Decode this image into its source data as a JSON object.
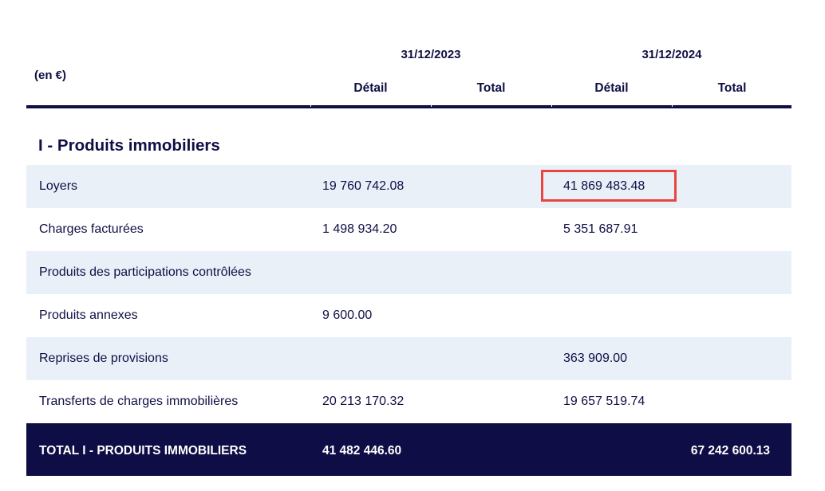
{
  "header": {
    "unit": "(en €)",
    "dates": [
      "31/12/2023",
      "31/12/2024"
    ],
    "subcols": [
      "Détail",
      "Total",
      "Détail",
      "Total"
    ]
  },
  "section": {
    "title": "I - Produits immobiliers"
  },
  "rows": [
    {
      "label": "Loyers",
      "detail_2023": "19 760 742.08",
      "detail_2024": "41 869 483.48"
    },
    {
      "label": "Charges facturées",
      "detail_2023": "1 498 934.20",
      "detail_2024": "5 351 687.91"
    },
    {
      "label": "Produits des participations contrôlées",
      "detail_2023": "",
      "detail_2024": ""
    },
    {
      "label": "Produits annexes",
      "detail_2023": "9 600.00",
      "detail_2024": ""
    },
    {
      "label": "Reprises de provisions",
      "detail_2023": "",
      "detail_2024": "363 909.00"
    },
    {
      "label": "Transferts de charges immobilières",
      "detail_2023": "20 213 170.32",
      "detail_2024": "19 657 519.74"
    }
  ],
  "total": {
    "label": "TOTAL I - PRODUITS IMMOBILIERS",
    "total_2023": "41 482 446.60",
    "total_2024": "67 242 600.13"
  },
  "colors": {
    "navy": "#0f0d45",
    "row_alt": "#eaf0f8",
    "highlight_border": "#e8463e"
  }
}
